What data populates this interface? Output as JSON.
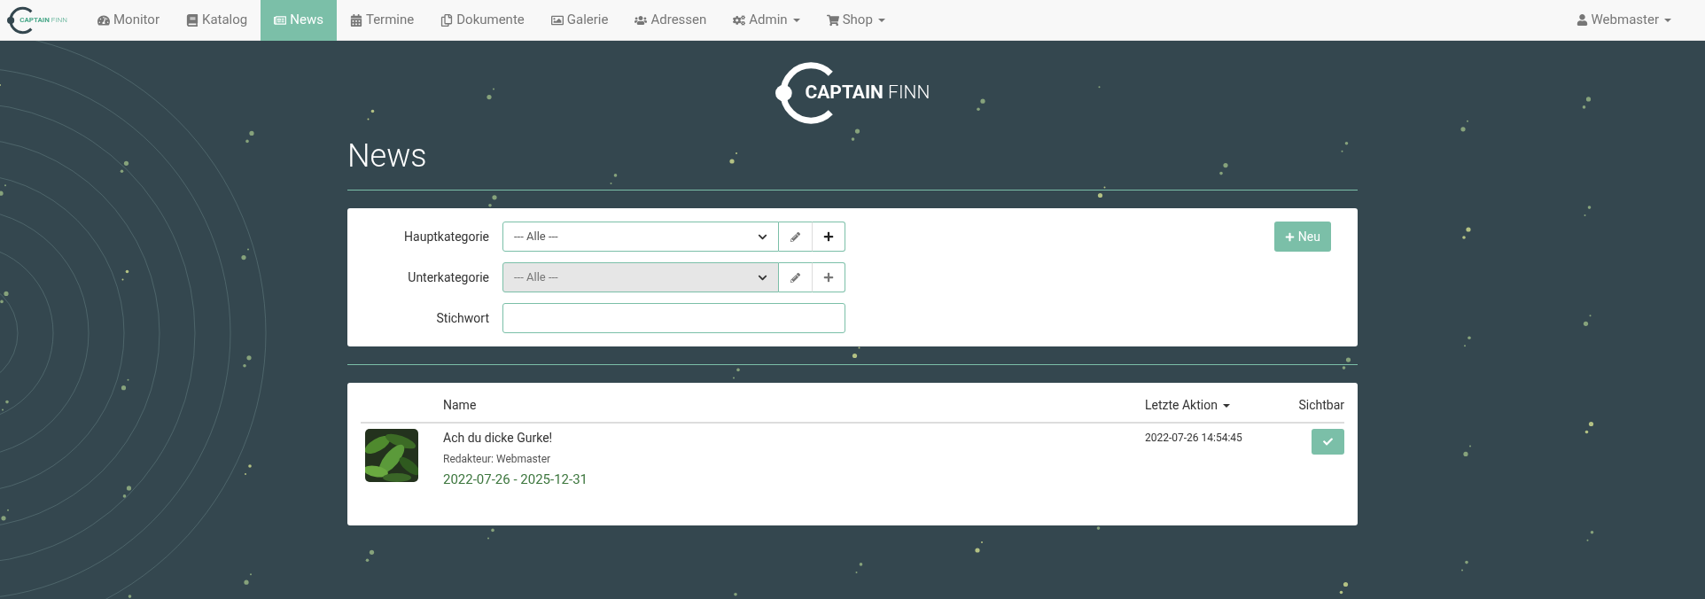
{
  "navbar": {
    "brand": {
      "bold": "CAPTAIN",
      "light": "FINN"
    },
    "items": [
      {
        "label": "Monitor",
        "selected": false,
        "has_menu": false
      },
      {
        "label": "Katalog",
        "selected": false,
        "has_menu": false
      },
      {
        "label": "News",
        "selected": true,
        "has_menu": false
      },
      {
        "label": "Termine",
        "selected": false,
        "has_menu": false
      },
      {
        "label": "Dokumente",
        "selected": false,
        "has_menu": false
      },
      {
        "label": "Galerie",
        "selected": false,
        "has_menu": false
      },
      {
        "label": "Adressen",
        "selected": false,
        "has_menu": false
      },
      {
        "label": "Admin",
        "selected": false,
        "has_menu": true
      },
      {
        "label": "Shop",
        "selected": false,
        "has_menu": true
      }
    ],
    "user": {
      "label": "Webmaster",
      "has_menu": true
    }
  },
  "logo": {
    "bold": "CAPTAIN",
    "light": "FINN"
  },
  "page_title": "News",
  "filters": [
    {
      "kind": "select",
      "label": "Hauptkategorie",
      "value": "--- Alle ---",
      "disabled": false
    },
    {
      "kind": "select",
      "label": "Unterkategorie",
      "value": "--- Alle ---",
      "disabled": true
    },
    {
      "kind": "text",
      "label": "Stichwort"
    }
  ],
  "new_button": "Neu",
  "table": {
    "columns": [
      {
        "label": "Name",
        "sorted": false
      },
      {
        "label": "Letzte Aktion",
        "sorted": true
      },
      {
        "label": "Sichtbar",
        "sorted": false
      }
    ],
    "rows": [
      {
        "title": "Ach du dicke Gurke!",
        "editor": "Redakteur: Webmaster",
        "period": "2022-07-26 - 2025-12-31",
        "last_action": "2022-07-26 14:54:45",
        "visible": true
      }
    ]
  }
}
